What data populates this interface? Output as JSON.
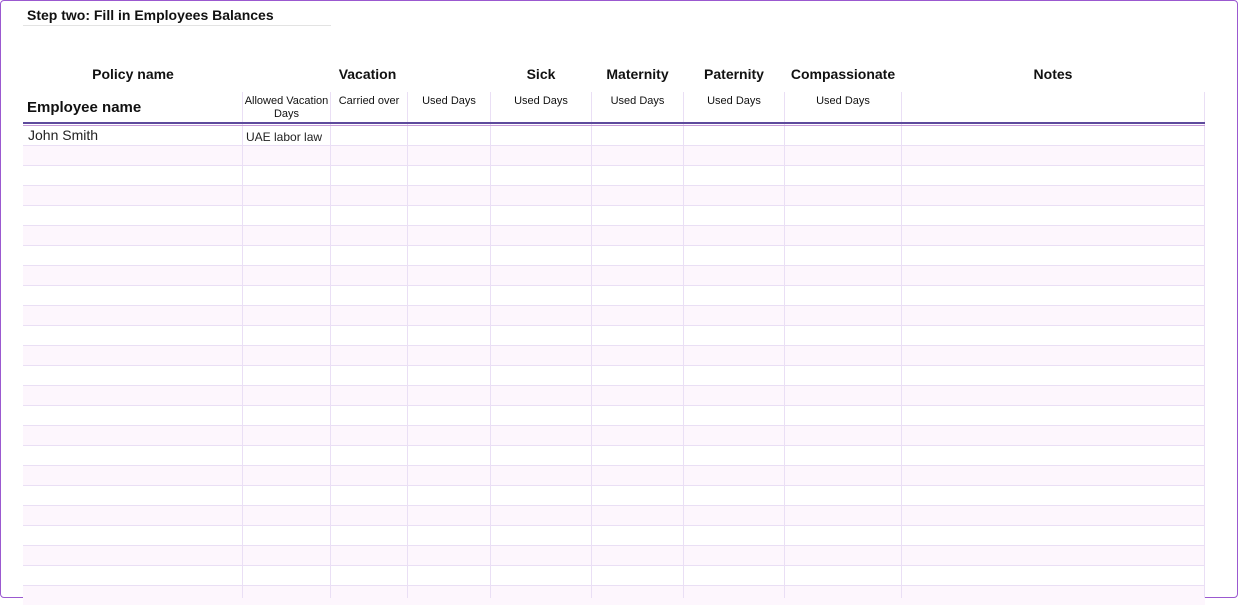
{
  "step_title": "Step two: Fill in Employees Balances",
  "headers": {
    "policy_name": "Policy name",
    "vacation": "Vacation",
    "sick": "Sick",
    "maternity": "Maternity",
    "paternity": "Paternity",
    "compassionate": "Compassionate",
    "notes": "Notes",
    "employee_name": "Employee name"
  },
  "subheaders": {
    "allowed_vacation_days": "Allowed Vacation Days",
    "carried_over": "Carried over",
    "vacation_used": "Used Days",
    "sick_used": "Used Days",
    "maternity_used": "Used Days",
    "paternity_used": "Used Days",
    "compassionate_used": "Used Days"
  },
  "rows": [
    {
      "employee_name": "John Smith",
      "policy": "UAE labor law"
    }
  ],
  "colors": {
    "frame": "#9b59d0",
    "grid": "#eadff5",
    "band": "#fdf6fd",
    "header_rule": "#5e4a9c"
  }
}
